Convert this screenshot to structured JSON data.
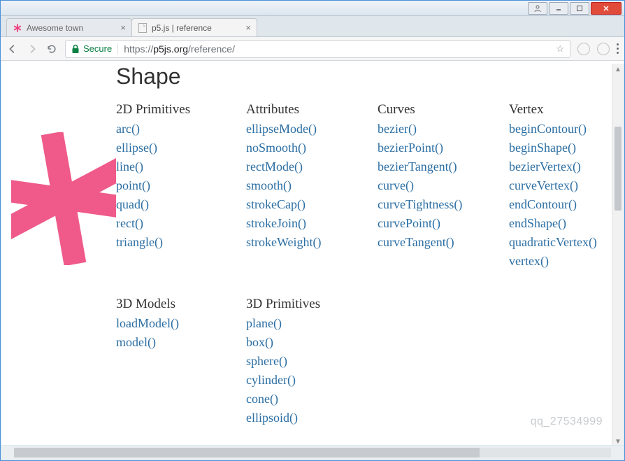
{
  "tabs": [
    {
      "title": "Awesome town"
    },
    {
      "title": "p5.js | reference"
    }
  ],
  "url": {
    "secure_label": "Secure",
    "scheme": "https://",
    "domain": "p5js.org",
    "path": "/reference/"
  },
  "heading": "Shape",
  "columns_row1": [
    {
      "title": "2D Primitives",
      "items": [
        "arc()",
        "ellipse()",
        "line()",
        "point()",
        "quad()",
        "rect()",
        "triangle()"
      ]
    },
    {
      "title": "Attributes",
      "items": [
        "ellipseMode()",
        "noSmooth()",
        "rectMode()",
        "smooth()",
        "strokeCap()",
        "strokeJoin()",
        "strokeWeight()"
      ]
    },
    {
      "title": "Curves",
      "items": [
        "bezier()",
        "bezierPoint()",
        "bezierTangent()",
        "curve()",
        "curveTightness()",
        "curvePoint()",
        "curveTangent()"
      ]
    },
    {
      "title": "Vertex",
      "items": [
        "beginContour()",
        "beginShape()",
        "bezierVertex()",
        "curveVertex()",
        "endContour()",
        "endShape()",
        "quadraticVertex()",
        "vertex()"
      ]
    }
  ],
  "columns_row2": [
    {
      "title": "3D Models",
      "items": [
        "loadModel()",
        "model()"
      ]
    },
    {
      "title": "3D Primitives",
      "items": [
        "plane()",
        "box()",
        "sphere()",
        "cylinder()",
        "cone()",
        "ellipsoid()"
      ]
    }
  ],
  "watermark": "qq_27534999"
}
